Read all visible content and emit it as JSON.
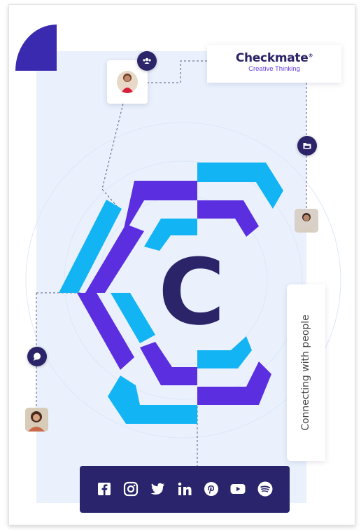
{
  "brand": {
    "name": "Checkmate",
    "mark": "®",
    "tagline": "Creative Thinking"
  },
  "logo": {
    "letter": "C"
  },
  "side_tag": {
    "text": "Connecting with people"
  },
  "badges": [
    "users-icon",
    "folder-icon",
    "chat-icon"
  ],
  "social": [
    {
      "name": "facebook-icon"
    },
    {
      "name": "instagram-icon"
    },
    {
      "name": "twitter-icon"
    },
    {
      "name": "linkedin-icon"
    },
    {
      "name": "pinterest-icon"
    },
    {
      "name": "youtube-icon"
    },
    {
      "name": "spotify-icon"
    }
  ],
  "colors": {
    "navy": "#2b2468",
    "purple": "#5b2ee0",
    "cyan": "#12b4f4",
    "panel": "#eaf1fd",
    "social_bar": "#29246b"
  }
}
